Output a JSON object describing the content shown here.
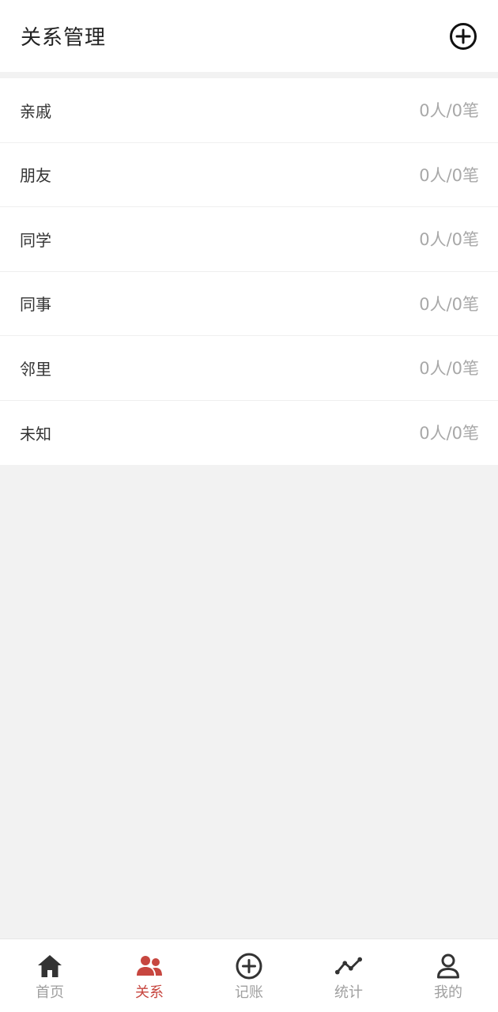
{
  "header": {
    "title": "关系管理"
  },
  "relations": [
    {
      "label": "亲戚",
      "stat": "0人/0笔"
    },
    {
      "label": "朋友",
      "stat": "0人/0笔"
    },
    {
      "label": "同学",
      "stat": "0人/0笔"
    },
    {
      "label": "同事",
      "stat": "0人/0笔"
    },
    {
      "label": "邻里",
      "stat": "0人/0笔"
    },
    {
      "label": "未知",
      "stat": "0人/0笔"
    }
  ],
  "tabbar": {
    "active_tab": "关系",
    "tabs": [
      {
        "label": "首页",
        "icon": "home-icon"
      },
      {
        "label": "关系",
        "icon": "people-icon"
      },
      {
        "label": "记账",
        "icon": "plus-circle-icon"
      },
      {
        "label": "统计",
        "icon": "trend-line-icon"
      },
      {
        "label": "我的",
        "icon": "user-icon"
      }
    ]
  },
  "colors": {
    "accent": "#c7463f",
    "icon_dark": "#333333",
    "tab_inactive": "#a0a0a0",
    "stat_text": "#a8a8a8",
    "background": "#f2f2f2"
  }
}
